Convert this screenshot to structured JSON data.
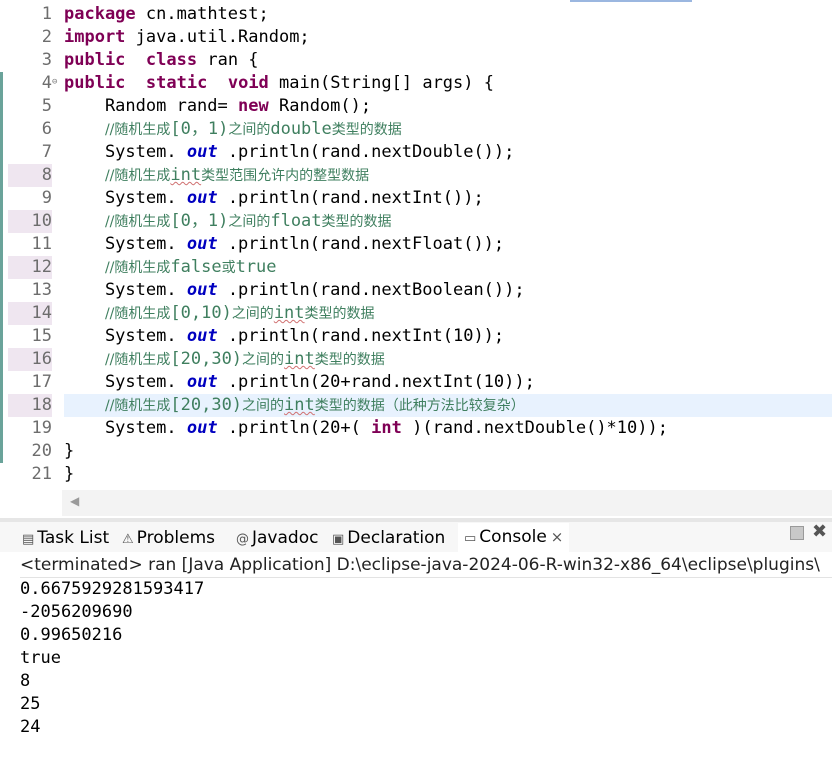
{
  "editor": {
    "lines": [
      {
        "no": "1",
        "parts": [
          [
            "kw",
            "package"
          ],
          [
            "",
            "cn.mathtest;"
          ]
        ]
      },
      {
        "no": "2",
        "parts": [
          [
            "kw",
            "import"
          ],
          [
            "",
            "java.util.Random;"
          ]
        ]
      },
      {
        "no": "3",
        "parts": [
          [
            "kw",
            "public"
          ],
          [
            "",
            ""
          ],
          [
            "kw",
            "class"
          ],
          [
            "",
            "ran {"
          ]
        ]
      },
      {
        "no": "4",
        "parts": [
          [
            "kw",
            "public"
          ],
          [
            "",
            ""
          ],
          [
            "kw",
            "static"
          ],
          [
            "",
            ""
          ],
          [
            "kw",
            "void"
          ],
          [
            "",
            "main(String[] args) {"
          ]
        ]
      },
      {
        "no": "5",
        "parts": [
          [
            "",
            "    Random rand="
          ],
          [
            "kw",
            "new"
          ],
          [
            "",
            "Random();"
          ]
        ]
      },
      {
        "no": "6",
        "comment": [
          [
            "",
            "//随机生成"
          ],
          [
            "m",
            "[0，1)"
          ],
          [
            "",
            "之间的"
          ],
          [
            "m",
            "double"
          ],
          [
            "",
            "类型的数据"
          ]
        ]
      },
      {
        "no": "7",
        "parts": [
          [
            "",
            "    System."
          ],
          [
            "st",
            "out"
          ],
          [
            "",
            ".println(rand.nextDouble());"
          ]
        ]
      },
      {
        "no": "8",
        "comment": [
          [
            "",
            "//随机生成"
          ],
          [
            "mw",
            "int"
          ],
          [
            "",
            "类型范围允许内的整型数据"
          ]
        ]
      },
      {
        "no": "9",
        "parts": [
          [
            "",
            "    System."
          ],
          [
            "st",
            "out"
          ],
          [
            "",
            ".println(rand.nextInt());"
          ]
        ]
      },
      {
        "no": "10",
        "comment": [
          [
            "",
            "//随机生成"
          ],
          [
            "m",
            "[0，1)"
          ],
          [
            "",
            "之间的"
          ],
          [
            "m",
            "float"
          ],
          [
            "",
            "类型的数据"
          ]
        ]
      },
      {
        "no": "11",
        "parts": [
          [
            "",
            "    System."
          ],
          [
            "st",
            "out"
          ],
          [
            "",
            ".println(rand.nextFloat());"
          ]
        ]
      },
      {
        "no": "12",
        "comment": [
          [
            "",
            "//随机生成"
          ],
          [
            "m",
            "false"
          ],
          [
            "",
            "或"
          ],
          [
            "m",
            "true"
          ]
        ]
      },
      {
        "no": "13",
        "parts": [
          [
            "",
            "    System."
          ],
          [
            "st",
            "out"
          ],
          [
            "",
            ".println(rand.nextBoolean());"
          ]
        ]
      },
      {
        "no": "14",
        "comment": [
          [
            "",
            "//随机生成"
          ],
          [
            "m",
            "[0,10)"
          ],
          [
            "",
            "之间的"
          ],
          [
            "mw",
            "int"
          ],
          [
            "",
            "类型的数据"
          ]
        ]
      },
      {
        "no": "15",
        "parts": [
          [
            "",
            "    System."
          ],
          [
            "st",
            "out"
          ],
          [
            "",
            ".println(rand.nextInt(10));"
          ]
        ]
      },
      {
        "no": "16",
        "comment": [
          [
            "",
            "//随机生成"
          ],
          [
            "m",
            "[20,30)"
          ],
          [
            "",
            "之间的"
          ],
          [
            "mw",
            "int"
          ],
          [
            "",
            "类型的数据"
          ]
        ]
      },
      {
        "no": "17",
        "parts": [
          [
            "",
            "    System."
          ],
          [
            "st",
            "out"
          ],
          [
            "",
            ".println(20+rand.nextInt(10));"
          ]
        ]
      },
      {
        "no": "18",
        "comment": [
          [
            "",
            "//随机生成"
          ],
          [
            "m",
            "[20,30)"
          ],
          [
            "",
            "之间的"
          ],
          [
            "mw",
            "int"
          ],
          [
            "",
            "类型的数据（此种方法比较复杂）"
          ]
        ]
      },
      {
        "no": "19",
        "parts": [
          [
            "",
            "    System."
          ],
          [
            "st",
            "out"
          ],
          [
            "",
            ".println(20+("
          ],
          [
            "kw",
            "int"
          ],
          [
            "",
            ")(rand.nextDouble()*10));"
          ]
        ]
      },
      {
        "no": "20",
        "parts": [
          [
            "",
            "}"
          ]
        ]
      },
      {
        "no": "21",
        "parts": [
          [
            "",
            "}"
          ]
        ]
      }
    ],
    "scroll_left_glyph": "◀"
  },
  "tabs": [
    {
      "icon": "▤",
      "label": "Task List",
      "name": "tab-task-list",
      "icon_name": "task-list-icon"
    },
    {
      "icon": "⚠",
      "label": "Problems",
      "name": "tab-problems",
      "icon_name": "problems-icon"
    },
    {
      "icon": "@",
      "label": "Javadoc",
      "name": "tab-javadoc",
      "icon_name": "javadoc-icon"
    },
    {
      "icon": "▣",
      "label": "Declaration",
      "name": "tab-declaration",
      "icon_name": "declaration-icon"
    }
  ],
  "console_tab": {
    "icon": "▭",
    "label": "Console",
    "close": "×"
  },
  "view_close": "✖",
  "console": {
    "status": "<terminated> ran [Java Application] D:\\eclipse-java-2024-06-R-win32-x86_64\\eclipse\\plugins\\",
    "output": [
      "0.6675929281593417",
      "-2056209690",
      "0.99650216",
      "true",
      "8",
      "25",
      "24"
    ]
  },
  "colors": {
    "keyword": "#7f0055",
    "static_field": "#0000c0",
    "comment": "#3f7f5f",
    "change_bar": "#6aa39a",
    "current_line": "#e8f2fe"
  }
}
